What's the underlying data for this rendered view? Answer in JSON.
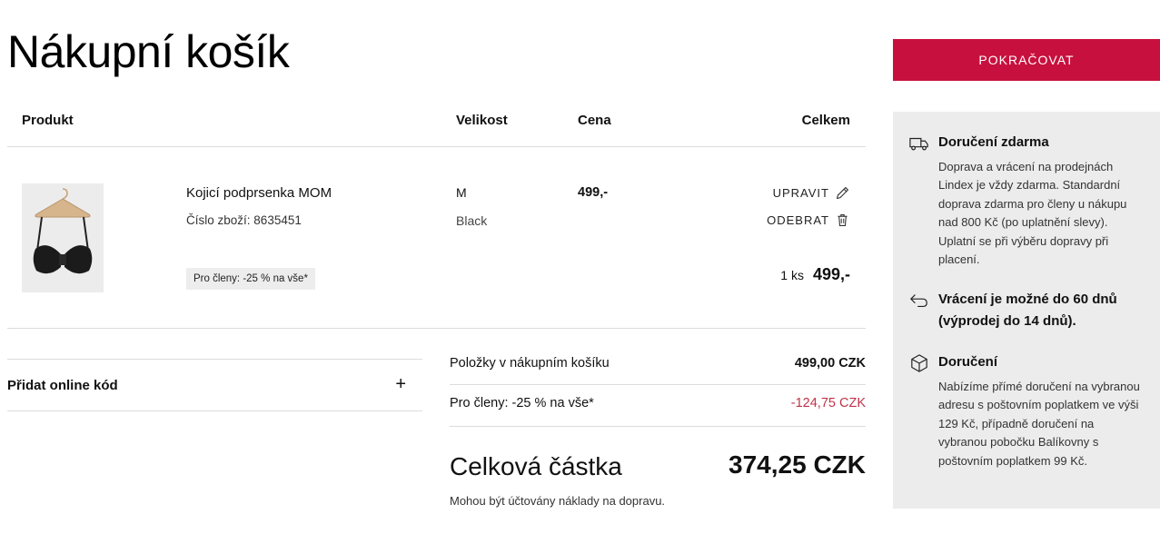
{
  "page": {
    "title": "Nákupní košík"
  },
  "cart": {
    "headers": {
      "product": "Produkt",
      "size": "Velikost",
      "price": "Cena",
      "total": "Celkem"
    },
    "items": [
      {
        "name": "Kojicí podprsenka MOM",
        "sku_label": "Číslo zboží:",
        "sku": "8635451",
        "promo": "Pro členy: -25 % na vše*",
        "size": "M",
        "color": "Black",
        "price": "499,-",
        "edit_label": "UPRAVIT",
        "remove_label": "ODEBRAT",
        "quantity": "1 ks",
        "line_total": "499,-"
      }
    ]
  },
  "promo_code": {
    "label": "Přidat online kód",
    "expand_symbol": "+"
  },
  "summary": {
    "items_label": "Položky v nákupním košíku",
    "items_value": "499,00 CZK",
    "discount_label": "Pro členy: -25 % na vše*",
    "discount_value": "-124,75 CZK",
    "total_label": "Celková částka",
    "total_value": "374,25 CZK",
    "shipping_note": "Mohou být účtovány náklady na dopravu."
  },
  "checkout": {
    "continue_label": "POKRAČOVAT"
  },
  "info": {
    "delivery_free": {
      "title": "Doručení zdarma",
      "text": "Doprava a vrácení na prodejnách Lindex je vždy zdarma. Standardní doprava zdarma pro členy u nákupu nad 800 Kč (po uplatnění slevy). Uplatní se při výběru dopravy při placení."
    },
    "returns": {
      "title": "Vrácení je možné do 60 dnů (výprodej do 14 dnů)."
    },
    "delivery": {
      "title": "Doručení",
      "text": "Nabízíme přímé doručení na vybranou adresu s poštovním poplatkem ve výši 129 Kč, případně doručení na vybranou pobočku Balíkovny s poštovním poplatkem 99 Kč."
    }
  },
  "colors": {
    "accent": "#c8103e",
    "discount": "#c0334a",
    "panel": "#ececec"
  },
  "icons": [
    "pencil-icon",
    "trash-icon",
    "truck-icon",
    "return-arrow-icon",
    "package-icon",
    "plus-icon"
  ]
}
